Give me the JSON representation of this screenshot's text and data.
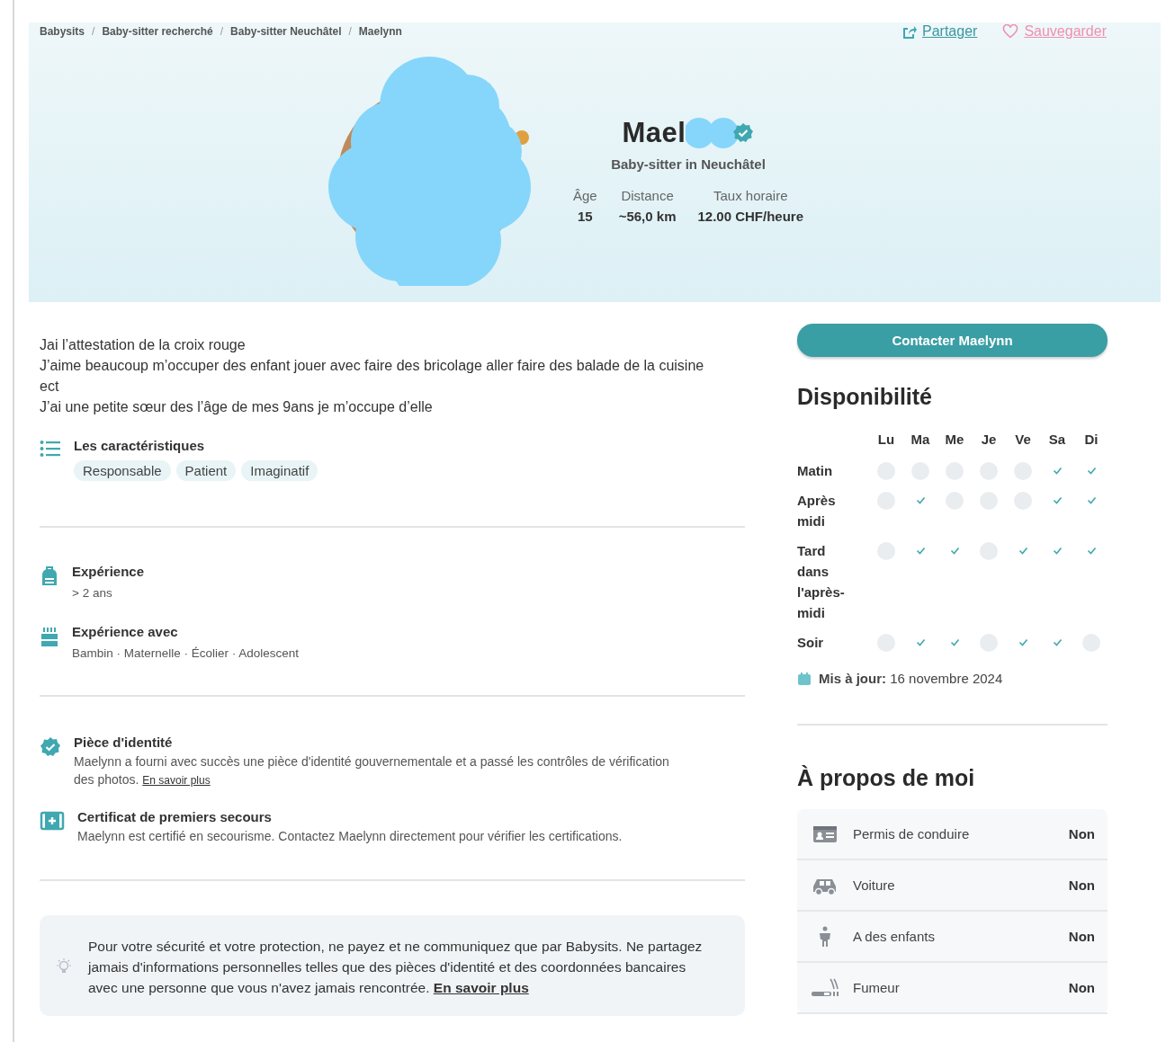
{
  "breadcrumbs": [
    {
      "label": "Babysits"
    },
    {
      "separator": "/",
      "label": "Baby-sitter recherché"
    },
    {
      "separator": "/",
      "label": "Baby-sitter Neuchâtel"
    },
    {
      "separator": "/",
      "label": "Maelynn"
    }
  ],
  "actions": [
    {
      "kind": "share",
      "label": "Partager"
    },
    {
      "kind": "save",
      "label": "Sauvegarder"
    }
  ],
  "profile": {
    "name": "Mael",
    "verified": true,
    "subtitle": "Baby-sitter in Neuchâtel",
    "stats": [
      {
        "label": "Âge",
        "value": "15"
      },
      {
        "label": "Distance",
        "value": "~56,0 km"
      },
      {
        "label": "Taux horaire",
        "value": "12.00 CHF/heure"
      }
    ]
  },
  "description": [
    "Jai l’attestation de la croix rouge",
    "J’aime beaucoup m’occuper des enfant jouer avec faire des bricolage aller faire des balade de la cuisine ect",
    "J’ai une petite sœur des l’âge de mes 9ans je m’occupe d’elle"
  ],
  "characteristics": {
    "title": "Les caractéristiques",
    "tags": [
      "Responsable",
      "Patient",
      "Imaginatif"
    ]
  },
  "experience": [
    {
      "kind": "backpack",
      "title": "Expérience",
      "value": "> 2 ans"
    },
    {
      "kind": "cake",
      "title": "Expérience avec",
      "value": "Bambin · Maternelle · Écolier · Adolescent"
    }
  ],
  "verifications": [
    {
      "kind": "badge",
      "title": "Pièce d'identité",
      "text": "Maelynn a fourni avec succès une pièce d'identité gouvernementale et a passé les contrôles de vérification des photos.",
      "link": "En savoir plus"
    },
    {
      "kind": "firstaid",
      "title": "Certificat de premiers secours",
      "text": "Maelynn est certifié en secourisme. Contactez Maelynn directement pour vérifier les certifications."
    }
  ],
  "safety_notice": {
    "text": "Pour votre sécurité et votre protection, ne payez et ne communiquez que par Babysits. Ne partagez jamais d'informations personnelles telles que des pièces d'identité et des coordonnées bancaires avec une personne que vous n'avez jamais rencontrée.",
    "link": "En savoir plus"
  },
  "contact_button": "Contacter Maelynn",
  "availability": {
    "title": "Disponibilité",
    "days": [
      "Lu",
      "Ma",
      "Me",
      "Je",
      "Ve",
      "Sa",
      "Di"
    ],
    "rows": [
      {
        "label": "Matin",
        "slots": [
          {
            "available": false
          },
          {
            "available": false
          },
          {
            "available": false
          },
          {
            "available": false
          },
          {
            "available": false
          },
          {
            "available": true
          },
          {
            "available": true
          }
        ]
      },
      {
        "label": "Après midi",
        "slots": [
          {
            "available": false
          },
          {
            "available": true
          },
          {
            "available": false
          },
          {
            "available": false
          },
          {
            "available": false
          },
          {
            "available": true
          },
          {
            "available": true
          }
        ]
      },
      {
        "label": "Tard dans l'après-midi",
        "slots": [
          {
            "available": false
          },
          {
            "available": true
          },
          {
            "available": true
          },
          {
            "available": false
          },
          {
            "available": true
          },
          {
            "available": true
          },
          {
            "available": true
          }
        ]
      },
      {
        "label": "Soir",
        "slots": [
          {
            "available": false
          },
          {
            "available": true
          },
          {
            "available": true
          },
          {
            "available": false
          },
          {
            "available": true
          },
          {
            "available": true
          },
          {
            "available": false
          }
        ]
      }
    ],
    "updated": "**Mis à jour:** 16 novembre 2024"
  },
  "about": {
    "title": "À propos de moi",
    "items": [
      {
        "kind": "license",
        "label": "Permis de conduire",
        "value": "Non"
      },
      {
        "kind": "car",
        "label": "Voiture",
        "value": "Non"
      },
      {
        "kind": "children",
        "label": "A des enfants",
        "value": "Non"
      },
      {
        "kind": "smoker",
        "label": "Fumeur",
        "value": "Non"
      }
    ]
  }
}
